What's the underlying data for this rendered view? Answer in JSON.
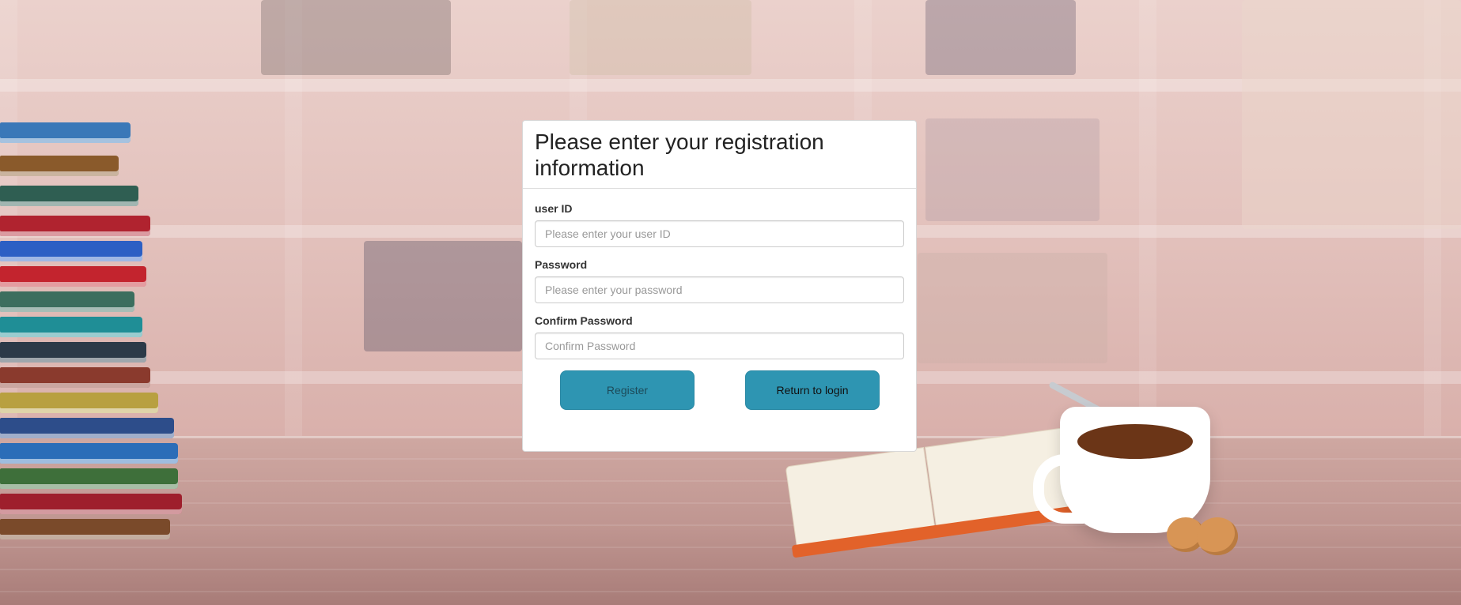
{
  "form": {
    "title": "Please enter your registration information",
    "fields": [
      {
        "label": "user ID",
        "placeholder": "Please enter your user ID",
        "value": ""
      },
      {
        "label": "Password",
        "placeholder": "Please enter your password",
        "value": ""
      },
      {
        "label": "Confirm Password",
        "placeholder": "Confirm Password",
        "value": ""
      }
    ],
    "buttons": {
      "register": "Register",
      "return_to_login": "Return to login"
    }
  },
  "colors": {
    "button_bg": "#2e95b2",
    "card_bg": "#ffffff",
    "background_tone": "#e3c2bd"
  }
}
